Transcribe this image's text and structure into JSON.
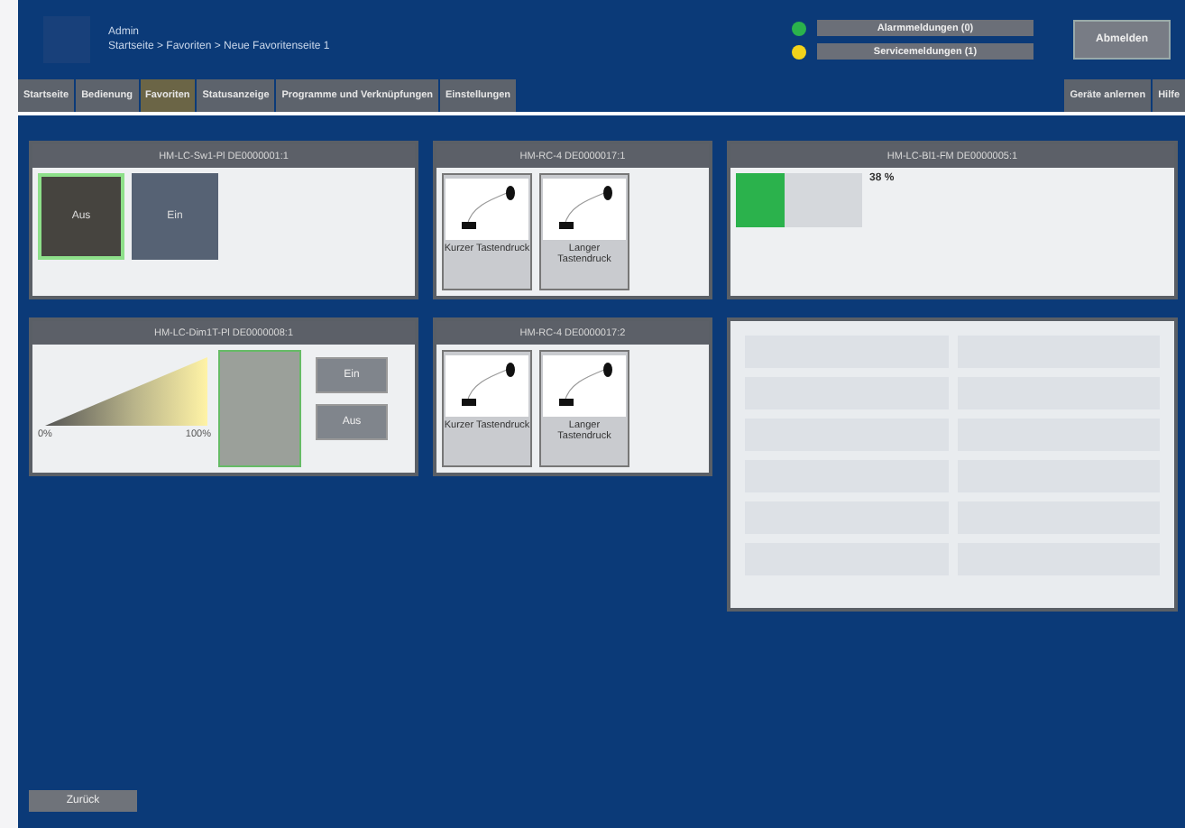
{
  "header": {
    "user": "Admin",
    "breadcrumb": "Startseite > Favoriten > Neue Favoritenseite 1"
  },
  "messages": [
    {
      "label": "Alarmmeldungen (0)",
      "color": "#2bb24c"
    },
    {
      "label": "Servicemeldungen (1)",
      "color": "#f2d21b"
    }
  ],
  "logout": "Abmelden",
  "tabs": [
    {
      "label": "Startseite",
      "selected": false
    },
    {
      "label": "Bedienung",
      "selected": false
    },
    {
      "label": "Favoriten",
      "selected": true
    },
    {
      "label": "Statusanzeige",
      "selected": false
    },
    {
      "label": "Programme und Verknüpfungen",
      "selected": false
    },
    {
      "label": "Einstellungen",
      "selected": false
    }
  ],
  "right_tabs": [
    {
      "label": "Geräte anlernen",
      "selected": false
    },
    {
      "label": "Hilfe",
      "selected": false
    }
  ],
  "cards": [
    {
      "kind": "switch",
      "title": "HM-LC-Sw1-Pl DE0000001:1",
      "buttons": [
        {
          "label": "Aus",
          "selected": true
        },
        {
          "label": "Ein",
          "selected": false
        }
      ]
    },
    {
      "kind": "remote",
      "title": "HM-RC-4 DE0000017:1",
      "keys": [
        "Kurzer Tastendruck",
        "Langer Tastendruck"
      ]
    },
    {
      "kind": "level",
      "title": "HM-LC-Bl1-FM DE0000005:1",
      "level": 0.38,
      "reading": "38 %"
    },
    {
      "kind": "dimmer",
      "title": "HM-LC-Dim1T-Pl DE0000008:1",
      "min": "0%",
      "max": "100%",
      "buttons": [
        {
          "label": "Ein"
        },
        {
          "label": "Aus"
        }
      ]
    },
    {
      "kind": "remote",
      "title": "HM-RC-4 DE0000017:2",
      "keys": [
        "Kurzer Tastendruck",
        "Langer Tastendruck"
      ]
    },
    {
      "kind": "list"
    }
  ],
  "back": "Zurück"
}
